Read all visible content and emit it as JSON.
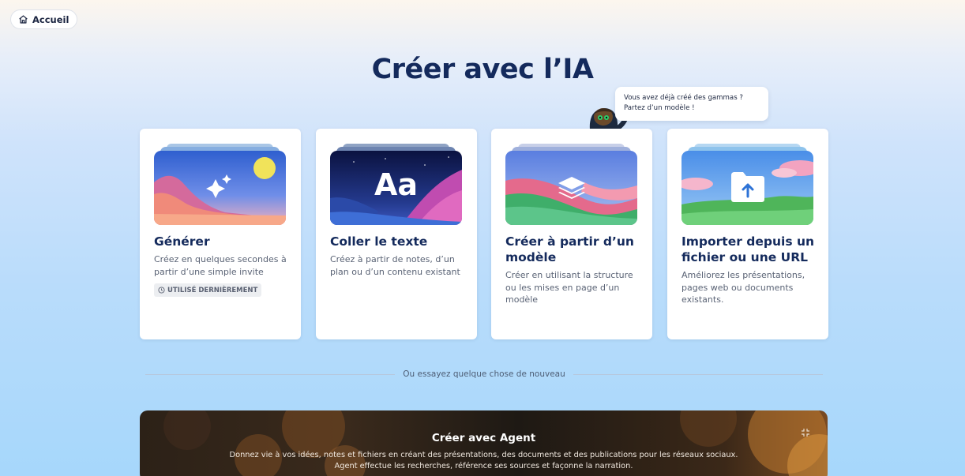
{
  "header": {
    "home_label": "Accueil"
  },
  "page": {
    "title": "Créer avec l’IA"
  },
  "tooltip": {
    "line1": "Vous avez déjà créé des gammas ?",
    "line2": "Partez d’un modèle !"
  },
  "cards": [
    {
      "title": "Générer",
      "description": "Créez en quelques secondes à partir d’une simple invite",
      "badge": "UTILISÉ DERNIÈREMENT",
      "icon": "sparkles-icon"
    },
    {
      "title": "Coller le texte",
      "description": "Créez à partir de notes, d’un plan ou d’un contenu existant",
      "icon": "text-aa-icon",
      "icon_text": "Aa"
    },
    {
      "title": "Créer à partir d’un modèle",
      "description": "Créer en utilisant la structure ou les mises en page d’un modèle",
      "icon": "layers-icon"
    },
    {
      "title": "Importer depuis un fichier ou une URL",
      "description": "Améliorez les présentations, pages web ou documents existants.",
      "icon": "upload-folder-icon"
    }
  ],
  "divider": {
    "text": "Ou essayez quelque chose de nouveau"
  },
  "agent": {
    "title": "Créer avec Agent",
    "description_line1": "Donnez vie à vos idées, notes et fichiers en créant des présentations, des documents et des publications pour les réseaux sociaux.",
    "description_line2": "Agent effectue les recherches, référence ses sources et façonne la narration."
  },
  "colors": {
    "title": "#142a5c",
    "card_bg": "#ffffff",
    "badge_bg": "#eceef1"
  }
}
